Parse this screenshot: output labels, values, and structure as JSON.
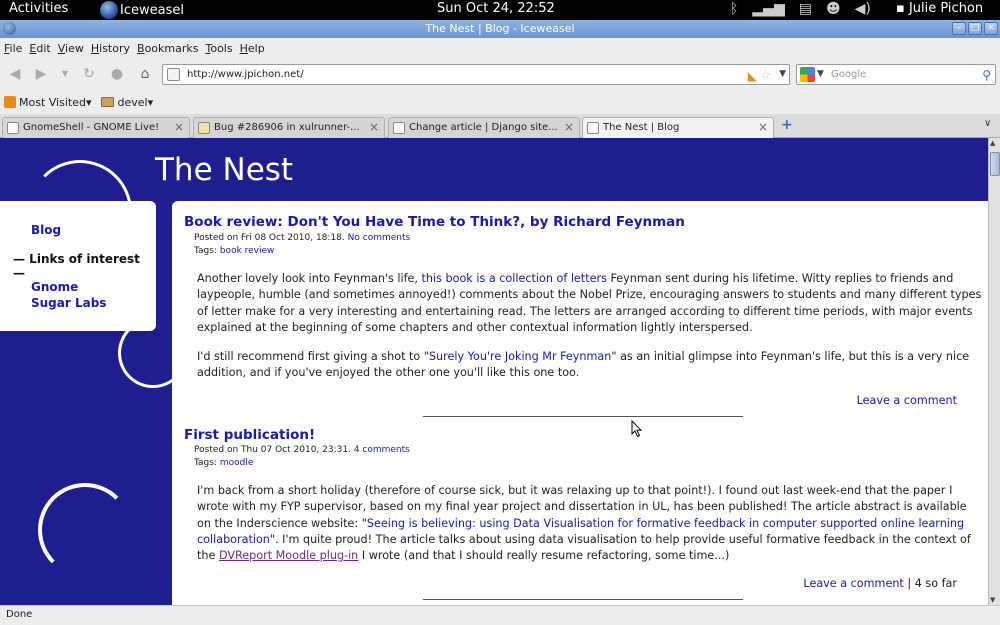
{
  "panel": {
    "activities": "Activities",
    "app_name": "Iceweasel",
    "clock": "Sun Oct 24, 22:52",
    "user": "Julie Pichon"
  },
  "window": {
    "title": "The Nest | Blog - Iceweasel"
  },
  "menu": [
    "File",
    "Edit",
    "View",
    "History",
    "Bookmarks",
    "Tools",
    "Help"
  ],
  "nav": {
    "url": "http://www.jpichon.net/",
    "search_placeholder": "Google"
  },
  "bookmarks": {
    "most_visited": "Most Visited",
    "devel": "devel"
  },
  "tabs": [
    {
      "label": "GnomeShell - GNOME Live!"
    },
    {
      "label": "Bug #286906 in xulrunner-..."
    },
    {
      "label": "Change article | Django site..."
    },
    {
      "label": "The Nest | Blog"
    }
  ],
  "site": {
    "title": "The Nest",
    "colors": {
      "background": "#1f1e8f",
      "link": "#1919b0"
    }
  },
  "sidebar": {
    "blog": "Blog",
    "links_heading": "— Links of interest —",
    "links": [
      "Gnome",
      "Sugar Labs"
    ]
  },
  "posts": [
    {
      "title": "Book review: Don't You Have Time to Think?, by Richard Feynman",
      "meta_prefix": "Posted on Fri 08 Oct 2010, 18:18.",
      "comments_link": "No comments",
      "tags_prefix": "Tags:",
      "tag": "book review",
      "p1_a": "Another lovely look into Feynman's life,",
      "p1_link": "this book is a collection of letters",
      "p1_b": "Feynman sent during his lifetime. Witty replies to friends and laypeople, humble (and sometimes annoyed!) comments about the Nobel Prize, encouraging answers to students and many different types of letter make for a very interesting and entertaining read. The letters are arranged according to different time periods, with major events explained at the beginning of some chapters and other contextual information lightly interspersed.",
      "p2_a": "I'd still recommend first giving a shot to \"",
      "p2_link": "Surely You're Joking Mr Feynman",
      "p2_b": "\" as an initial glimpse into Feynman's life, but this is a very nice addition, and if you've enjoyed the other one you'll like this one too.",
      "leave_comment": "Leave a comment"
    },
    {
      "title": "First publication!",
      "meta_prefix": "Posted on Thu 07 Oct 2010, 23:31.",
      "comments_link": "4 comments",
      "tags_prefix": "Tags:",
      "tag": "moodle",
      "p1_a": "I'm back from a short holiday (therefore of course sick, but it was relaxing up to that point!). I found out last week-end that the paper I wrote with my FYP supervisor, based on my final year project and dissertation in UL, has been published! The article abstract is available on the Inderscience website: \"",
      "p1_link": "Seeing is believing: using Data Visualisation for formative feedback in computer supported online learning collaboration",
      "p1_b": "\". I'm quite proud! The article talks about using data visualisation to help provide useful formative feedback in the context of the",
      "p1_link2": "DVReport Moodle plug-in",
      "p1_c": "I wrote (and that I should really resume refactoring, some time...)",
      "leave_comment": "Leave a comment",
      "so_far": "| 4 so far"
    }
  ],
  "status": "Done"
}
